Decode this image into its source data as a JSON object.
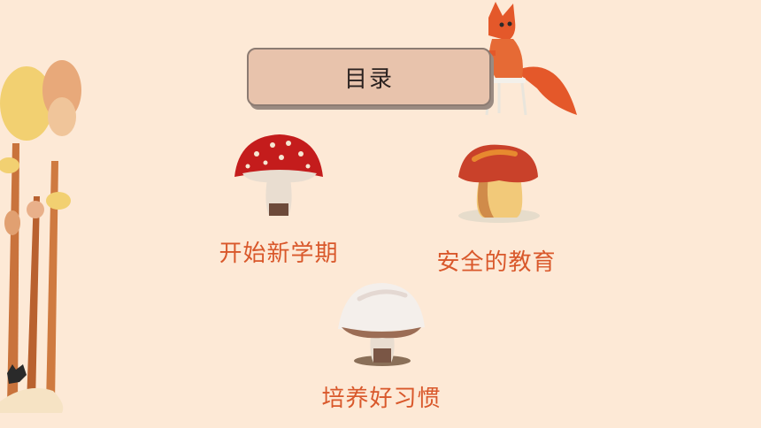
{
  "slide": {
    "title": "目录",
    "items": [
      {
        "label": "开始新学期",
        "icon": "red-spotted-mushroom-icon"
      },
      {
        "label": "安全的教育",
        "icon": "orange-mushroom-icon"
      },
      {
        "label": "培养好习惯",
        "icon": "white-mushroom-icon"
      }
    ]
  },
  "colors": {
    "background": "#fde9d6",
    "title_box": "#e8c3ac",
    "label_text": "#d9582b"
  }
}
